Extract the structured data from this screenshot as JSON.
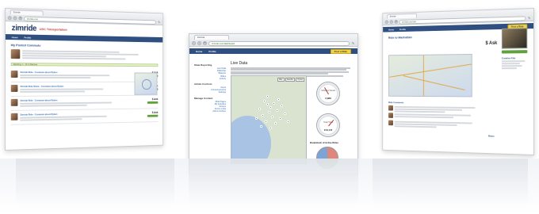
{
  "left": {
    "tab_title": "Zimride",
    "url": "zimride.com",
    "logo": "zimride",
    "logo_sub": "USC Transportation",
    "nav": [
      "Home",
      "Profile"
    ],
    "post_button": "Post a Ride",
    "page_title": "My Posted Commute",
    "banner": "Matching: 1 - 15 of Matches",
    "rides": [
      {
        "title": "Zimride Ride - Commute about Ryden",
        "ask": "$ Ask"
      },
      {
        "title": "Zimride Ride Share - Commute about Ryden",
        "ask": "$ Ask"
      },
      {
        "title": "Zimride Ride - Commute about Ryden",
        "ask": "$ Ask"
      },
      {
        "title": "Zimride Ride - Commute about Ryden",
        "ask": "$ Ask"
      }
    ]
  },
  "center": {
    "tab_title": "Zimride",
    "url": "zimride.com/dashboard",
    "logo": "zimride",
    "nav": [
      "Home",
      "Profile"
    ],
    "post_button": "Post a Ride",
    "sidebar": [
      {
        "heading": "State Reporting",
        "links": [
          "Live Data",
          "Ridership",
          "Balance",
          "Rides",
          "Activity"
        ]
      },
      {
        "heading": "Admin Controls",
        "links": [
          "Users",
          "Announcements",
          "Settings"
        ]
      },
      {
        "heading": "Manage Content",
        "links": [
          "Ride Pages",
          "My Activities",
          "Groups",
          "Forms Links",
          "Admin Archive"
        ]
      }
    ],
    "title": "Live Data",
    "map_buttons": [
      "Map",
      "Satellite",
      "Hybrid"
    ],
    "gauge1": {
      "label": "Vehicles Saved",
      "value": "2,989"
    },
    "gauge2": {
      "label": "Total Trips",
      "value": "116,147"
    },
    "pie_title": "Breakdown of Active Rides"
  },
  "right": {
    "tab_title": "Zimride",
    "url": "zimride.com/ride",
    "logo": "zimride",
    "nav": [
      "Home",
      "Profile"
    ],
    "post_button": "Post a Ride",
    "page_title": "Ride to Manhattan",
    "ask": "$ Ask",
    "sections": [
      "Ride Comments",
      "Rides"
    ],
    "profile_name": "Creative Kim"
  },
  "colors": {
    "nav": "#2e4f7f",
    "accent_yellow": "#f2d44c",
    "green": "#5fa23a"
  }
}
